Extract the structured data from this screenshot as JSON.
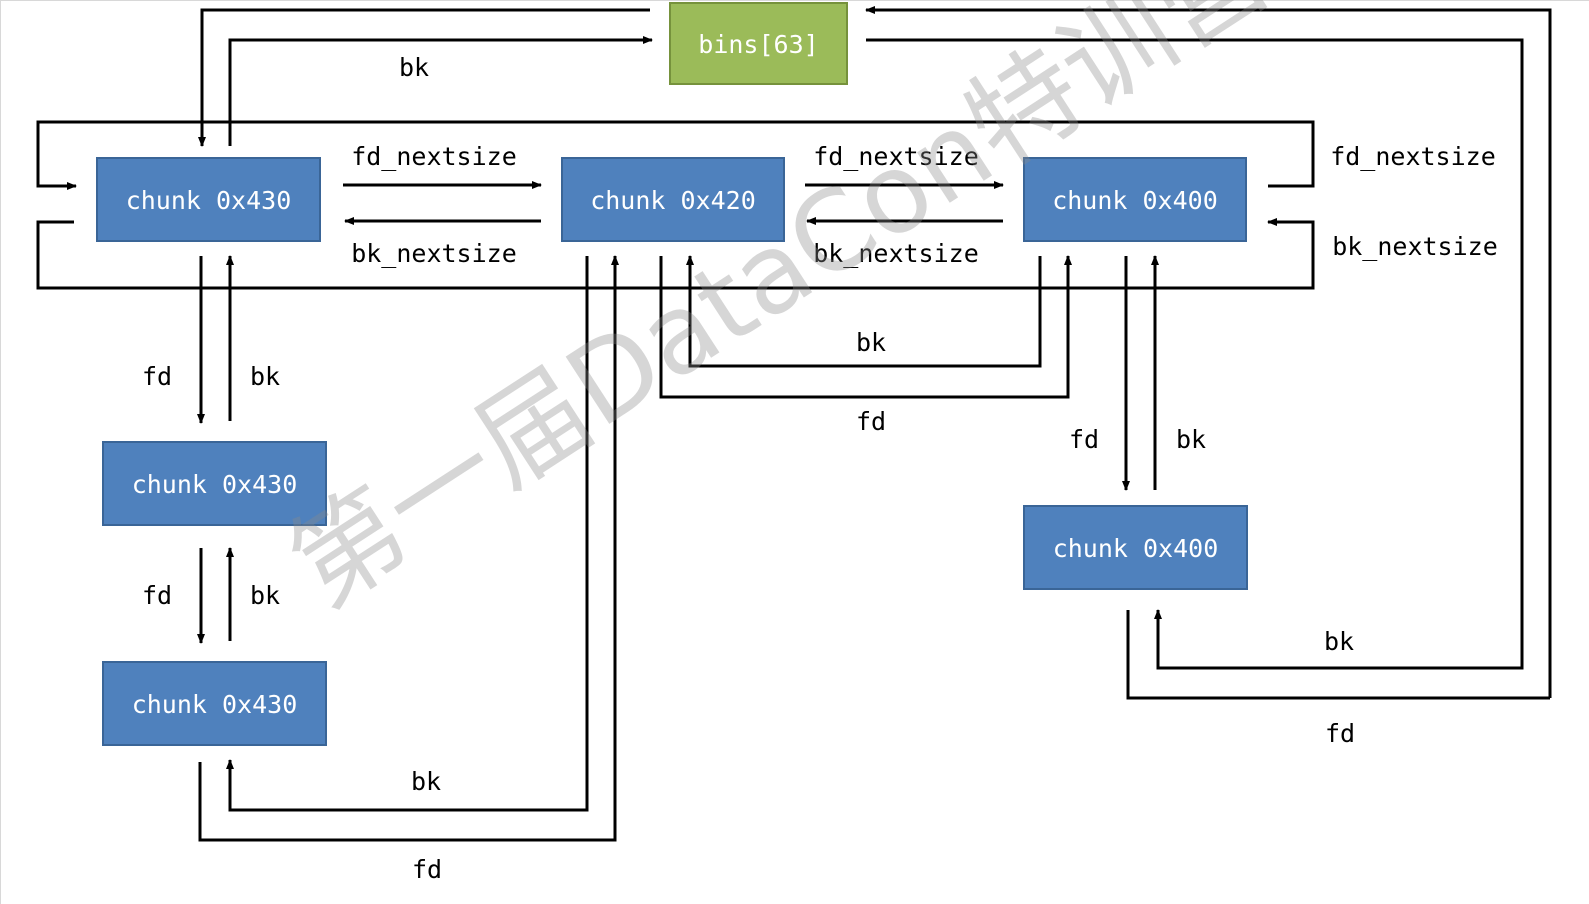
{
  "nodes": {
    "bins": "bins[63]",
    "chunk_a": "chunk 0x430",
    "chunk_b": "chunk 0x420",
    "chunk_c": "chunk 0x400",
    "chunk_a2": "chunk 0x430",
    "chunk_a3": "chunk 0x430",
    "chunk_c2": "chunk 0x400"
  },
  "edge_labels": {
    "fd": "fd",
    "bk": "bk",
    "fd_nextsize": "fd_nextsize",
    "bk_nextsize": "bk_nextsize"
  },
  "watermark": "第一届DataCon特训营",
  "colors": {
    "chunk_fill": "#4f81bd",
    "chunk_border": "#3a6597",
    "bins_fill": "#9bbb59",
    "bins_border": "#76923c",
    "line": "#000000"
  }
}
